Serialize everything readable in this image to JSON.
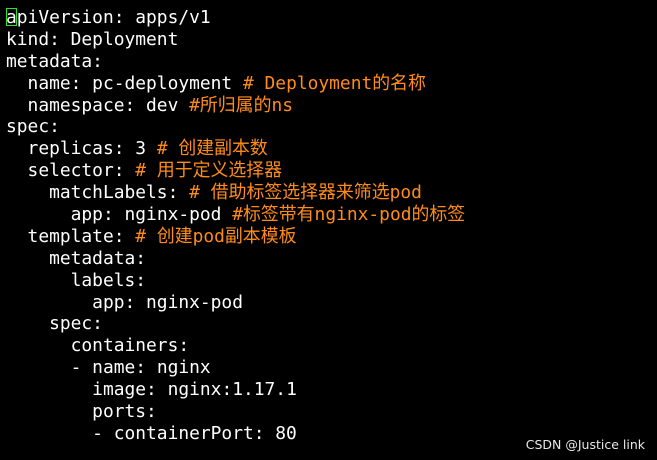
{
  "editor": {
    "lines": [
      {
        "indent": "",
        "key": "apiVersion:",
        "value": " apps/v1",
        "comment": ""
      },
      {
        "indent": "",
        "key": "kind:",
        "value": " Deployment",
        "comment": ""
      },
      {
        "indent": "",
        "key": "metadata:",
        "value": "",
        "comment": ""
      },
      {
        "indent": "  ",
        "key": "name:",
        "value": " pc-deployment ",
        "comment": "# Deployment的名称"
      },
      {
        "indent": "  ",
        "key": "namespace:",
        "value": " dev ",
        "comment": "#所归属的ns"
      },
      {
        "indent": "",
        "key": "spec:",
        "value": "",
        "comment": ""
      },
      {
        "indent": "  ",
        "key": "replicas:",
        "value": " 3 ",
        "comment": "# 创建副本数"
      },
      {
        "indent": "  ",
        "key": "selector:",
        "value": " ",
        "comment": "# 用于定义选择器"
      },
      {
        "indent": "    ",
        "key": "matchLabels:",
        "value": " ",
        "comment": "# 借助标签选择器来筛选pod"
      },
      {
        "indent": "      ",
        "key": "app:",
        "value": " nginx-pod ",
        "comment": "#标签带有nginx-pod的标签"
      },
      {
        "indent": "  ",
        "key": "template:",
        "value": " ",
        "comment": "# 创建pod副本模板"
      },
      {
        "indent": "    ",
        "key": "metadata:",
        "value": "",
        "comment": ""
      },
      {
        "indent": "      ",
        "key": "labels:",
        "value": "",
        "comment": ""
      },
      {
        "indent": "        ",
        "key": "app:",
        "value": " nginx-pod",
        "comment": ""
      },
      {
        "indent": "    ",
        "key": "spec:",
        "value": "",
        "comment": ""
      },
      {
        "indent": "      ",
        "key": "containers:",
        "value": "",
        "comment": ""
      },
      {
        "indent": "      ",
        "key": "- name:",
        "value": " nginx",
        "comment": ""
      },
      {
        "indent": "        ",
        "key": "image:",
        "value": " nginx:1.17.1",
        "comment": ""
      },
      {
        "indent": "        ",
        "key": "ports:",
        "value": "",
        "comment": ""
      },
      {
        "indent": "        ",
        "key": "- containerPort:",
        "value": " 80",
        "comment": ""
      }
    ]
  },
  "watermark": {
    "text": "CSDN @Justice link"
  },
  "colors": {
    "background": "#000000",
    "text": "#ffffff",
    "comment": "#ff8c1a",
    "cursor": "#2ee02e"
  }
}
